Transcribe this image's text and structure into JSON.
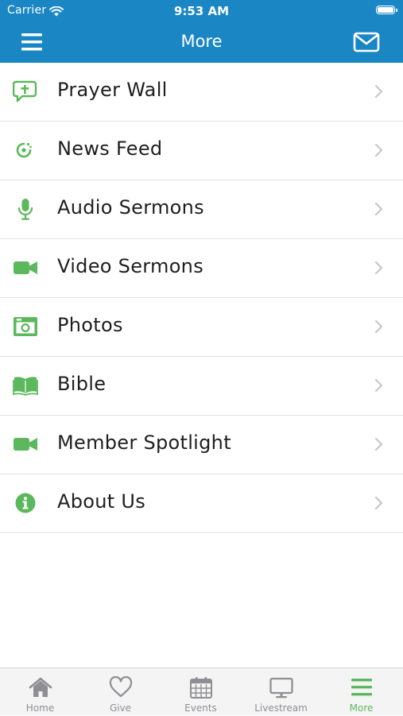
{
  "status_bar": {
    "carrier": "Carrier",
    "time": "9:53 AM"
  },
  "nav": {
    "title": "More",
    "left_icon": "hamburger-menu-icon",
    "right_icon": "envelope-icon"
  },
  "colors": {
    "header": "#1a87c4",
    "accent": "#5cb85c",
    "text": "#1e1e1e",
    "chevron": "#c7c7cc",
    "tab_inactive": "#8e8e93"
  },
  "menu": {
    "items": [
      {
        "label": "Prayer Wall",
        "icon": "prayer-speech-bubble-icon"
      },
      {
        "label": "News Feed",
        "icon": "rss-feed-icon"
      },
      {
        "label": "Audio Sermons",
        "icon": "microphone-icon"
      },
      {
        "label": "Video Sermons",
        "icon": "video-camera-icon"
      },
      {
        "label": "Photos",
        "icon": "camera-icon"
      },
      {
        "label": "Bible",
        "icon": "open-book-icon"
      },
      {
        "label": "Member Spotlight",
        "icon": "video-camera-icon"
      },
      {
        "label": "About Us",
        "icon": "info-circle-icon"
      }
    ]
  },
  "tabs": [
    {
      "label": "Home",
      "icon": "home-icon",
      "active": false
    },
    {
      "label": "Give",
      "icon": "heart-icon",
      "active": false
    },
    {
      "label": "Events",
      "icon": "calendar-icon",
      "active": false
    },
    {
      "label": "Livestream",
      "icon": "monitor-icon",
      "active": false
    },
    {
      "label": "More",
      "icon": "hamburger-menu-icon",
      "active": true
    }
  ]
}
